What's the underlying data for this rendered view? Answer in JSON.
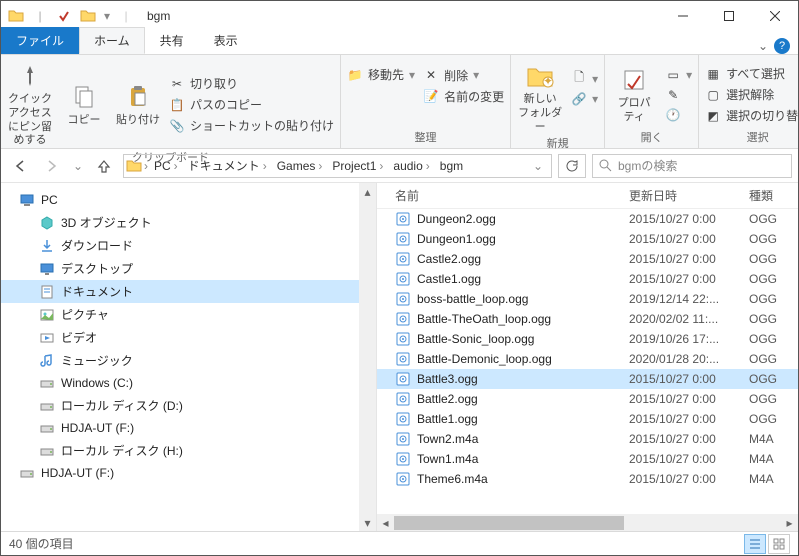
{
  "window": {
    "title": "bgm"
  },
  "tabs": {
    "file": "ファイル",
    "home": "ホーム",
    "share": "共有",
    "view": "表示"
  },
  "ribbon": {
    "clipboard": {
      "label": "クリップボード",
      "pin": "クイック アクセス\nにピン留めする",
      "copy": "コピー",
      "paste": "貼り付け",
      "cut": "切り取り",
      "copypath": "パスのコピー",
      "pasteshortcut": "ショートカットの貼り付け"
    },
    "organize": {
      "label": "整理",
      "moveto": "移動先",
      "delete": "削除",
      "rename": "名前の変更"
    },
    "new": {
      "label": "新規",
      "newfolder": "新しい\nフォルダー"
    },
    "open": {
      "label": "開く",
      "properties": "プロパ\nティ"
    },
    "select": {
      "label": "選択",
      "selectall": "すべて選択",
      "selectnone": "選択解除",
      "invert": "選択の切り替え"
    }
  },
  "breadcrumb": [
    "PC",
    "ドキュメント",
    "Games",
    "Project1",
    "audio",
    "bgm"
  ],
  "search": {
    "placeholder": "bgmの検索"
  },
  "tree": [
    {
      "icon": "pc",
      "label": "PC",
      "indent": false
    },
    {
      "icon": "cube",
      "label": "3D オブジェクト",
      "indent": true
    },
    {
      "icon": "download",
      "label": "ダウンロード",
      "indent": true
    },
    {
      "icon": "desktop",
      "label": "デスクトップ",
      "indent": true
    },
    {
      "icon": "doc",
      "label": "ドキュメント",
      "indent": true,
      "sel": true
    },
    {
      "icon": "pic",
      "label": "ピクチャ",
      "indent": true
    },
    {
      "icon": "video",
      "label": "ビデオ",
      "indent": true
    },
    {
      "icon": "music",
      "label": "ミュージック",
      "indent": true
    },
    {
      "icon": "drive",
      "label": "Windows (C:)",
      "indent": true
    },
    {
      "icon": "drive",
      "label": "ローカル ディスク (D:)",
      "indent": true
    },
    {
      "icon": "drive",
      "label": "HDJA-UT (F:)",
      "indent": true
    },
    {
      "icon": "drive",
      "label": "ローカル ディスク (H:)",
      "indent": true
    },
    {
      "icon": "drive",
      "label": "HDJA-UT (F:)",
      "indent": false
    }
  ],
  "columns": {
    "name": "名前",
    "date": "更新日時",
    "type": "種類"
  },
  "files": [
    {
      "name": "Dungeon2.ogg",
      "date": "2015/10/27 0:00",
      "type": "OGG"
    },
    {
      "name": "Dungeon1.ogg",
      "date": "2015/10/27 0:00",
      "type": "OGG"
    },
    {
      "name": "Castle2.ogg",
      "date": "2015/10/27 0:00",
      "type": "OGG"
    },
    {
      "name": "Castle1.ogg",
      "date": "2015/10/27 0:00",
      "type": "OGG"
    },
    {
      "name": "boss-battle_loop.ogg",
      "date": "2019/12/14 22:...",
      "type": "OGG"
    },
    {
      "name": "Battle-TheOath_loop.ogg",
      "date": "2020/02/02 11:...",
      "type": "OGG"
    },
    {
      "name": "Battle-Sonic_loop.ogg",
      "date": "2019/10/26 17:...",
      "type": "OGG"
    },
    {
      "name": "Battle-Demonic_loop.ogg",
      "date": "2020/01/28 20:...",
      "type": "OGG"
    },
    {
      "name": "Battle3.ogg",
      "date": "2015/10/27 0:00",
      "type": "OGG",
      "sel": true
    },
    {
      "name": "Battle2.ogg",
      "date": "2015/10/27 0:00",
      "type": "OGG"
    },
    {
      "name": "Battle1.ogg",
      "date": "2015/10/27 0:00",
      "type": "OGG"
    },
    {
      "name": "Town2.m4a",
      "date": "2015/10/27 0:00",
      "type": "M4A"
    },
    {
      "name": "Town1.m4a",
      "date": "2015/10/27 0:00",
      "type": "M4A"
    },
    {
      "name": "Theme6.m4a",
      "date": "2015/10/27 0:00",
      "type": "M4A"
    }
  ],
  "status": {
    "count": "40 個の項目"
  }
}
